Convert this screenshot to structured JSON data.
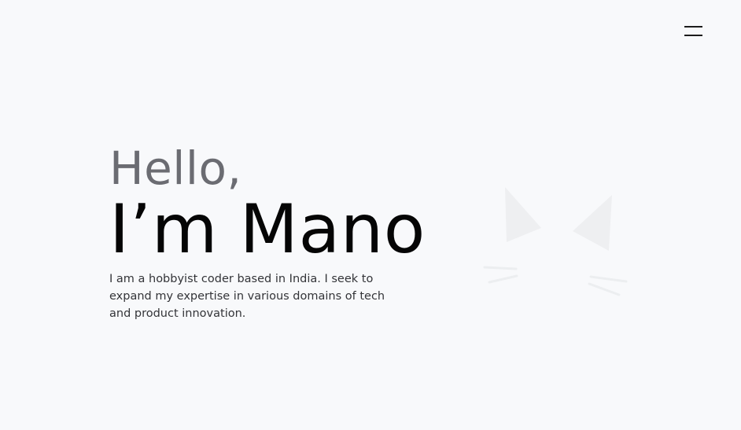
{
  "menu": {
    "icon": "hamburger-menu-icon"
  },
  "hero": {
    "greeting": "Hello,",
    "name": "I’m Mano",
    "bio": "I am a hobbyist coder based in India. I seek to expand my expertise in various domains of tech and product innovation."
  },
  "decoration": {
    "icon": "cat-face-icon",
    "color": "#f0f1f3"
  }
}
